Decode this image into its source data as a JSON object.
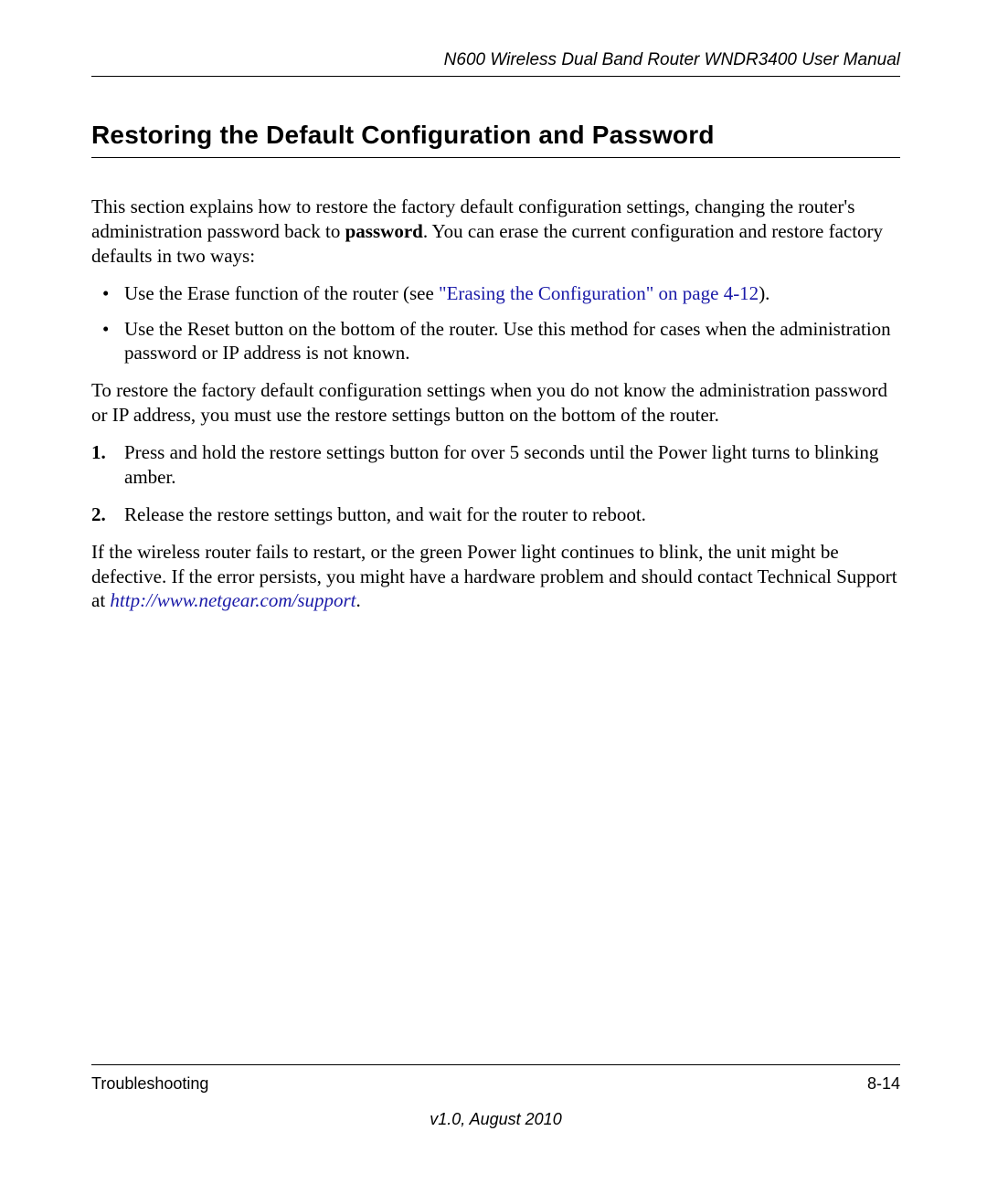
{
  "header": {
    "doc_title": "N600 Wireless Dual Band Router WNDR3400 User Manual"
  },
  "section": {
    "title": "Restoring the Default Configuration and Password"
  },
  "intro": {
    "p1a": "This section explains how to restore the factory default configuration settings, changing the router's administration password back to ",
    "p1_bold": "password",
    "p1b": ". You can erase the current configuration and restore factory defaults in two ways:"
  },
  "bullets": {
    "b1a": "Use the Erase function of the router (see ",
    "b1_link": "\"Erasing the Configuration\" on page 4-12",
    "b1b": ").",
    "b2": "Use the Reset button on the bottom of the router. Use this method for cases when the administration password or IP address is not known."
  },
  "mid": {
    "p2": "To restore the factory default configuration settings when you do not know the administration password or IP address, you must use the restore settings button on the bottom of the router."
  },
  "steps": {
    "s1_num": "1.",
    "s1": "Press and hold the restore settings button for over 5 seconds until the Power light turns to blinking amber.",
    "s2_num": "2.",
    "s2": "Release the restore settings button, and wait for the router to reboot."
  },
  "outro": {
    "p3a": "If the wireless router fails to restart, or the green Power light continues to blink, the unit might be defective. If the error persists, you might have a hardware problem and should contact Technical Support at ",
    "p3_link": "http://www.netgear.com/support",
    "p3b": "."
  },
  "footer": {
    "section_name": "Troubleshooting",
    "page_num": "8-14",
    "version": "v1.0, August 2010"
  }
}
